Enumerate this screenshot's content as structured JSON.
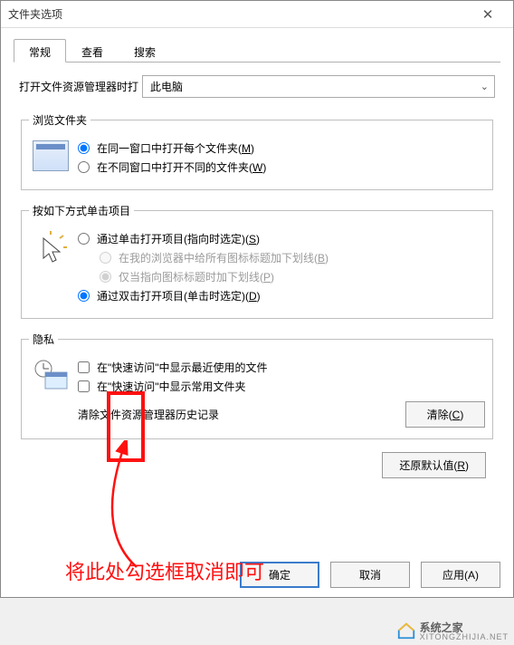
{
  "window": {
    "title": "文件夹选项",
    "close": "✕"
  },
  "tabs": [
    "常规",
    "查看",
    "搜索"
  ],
  "openWith": {
    "label": "打开文件资源管理器时打",
    "value": "此电脑"
  },
  "browseFolder": {
    "legend": "浏览文件夹",
    "opt1": "在同一窗口中打开每个文件夹(",
    "opt1_key": "M",
    "opt2": "在不同窗口中打开不同的文件夹(",
    "opt2_key": "W"
  },
  "clickMode": {
    "legend": "按如下方式单击项目",
    "opt1": "通过单击打开项目(指向时选定)(",
    "opt1_key": "S",
    "sub1": "在我的浏览器中给所有图标标题加下划线(",
    "sub1_key": "B",
    "sub2": "仅当指向图标标题时加下划线(",
    "sub2_key": "P",
    "opt2": "通过双击打开项目(单击时选定)(",
    "opt2_key": "D"
  },
  "privacy": {
    "legend": "隐私",
    "chk1": "在\"快速访问\"中显示最近使用的文件",
    "chk2": "在\"快速访问\"中显示常用文件夹",
    "clearLabel": "清除文件资源管理器历史记录",
    "clearBtn": "清除(",
    "clearBtn_key": "C"
  },
  "restore": {
    "label": "还原默认值(",
    "key": "R"
  },
  "buttons": {
    "ok": "确定",
    "cancel": "取消",
    "apply": "应用(A)"
  },
  "annotation": "将此处勾选框取消即可",
  "watermark": {
    "name": "系统之家",
    "url": "XITONGZHIJIA.NET"
  }
}
